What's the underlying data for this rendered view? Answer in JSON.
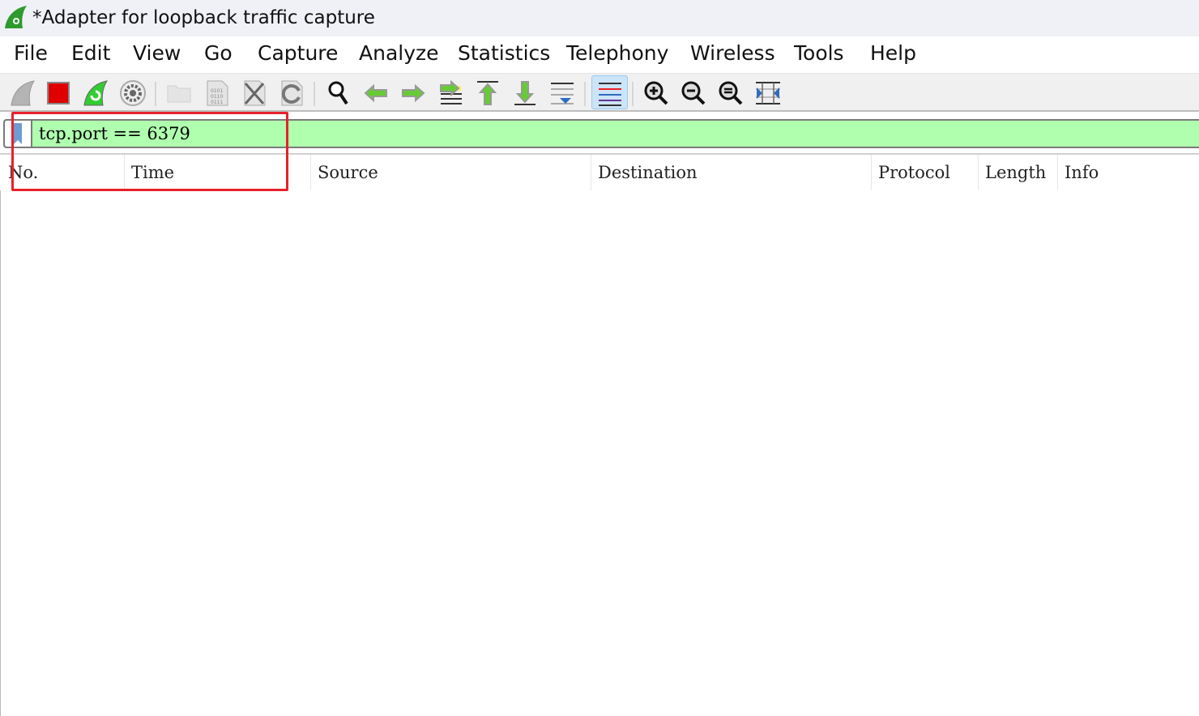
{
  "window": {
    "title": "*Adapter for loopback traffic capture",
    "icon": "wireshark-fin-icon"
  },
  "menu": [
    "File",
    "Edit",
    "View",
    "Go",
    "Capture",
    "Analyze",
    "Statistics",
    "Telephony",
    "Wireless",
    "Tools",
    "Help"
  ],
  "toolbar": [
    {
      "name": "start-capture",
      "icon": "shark-fin-icon"
    },
    {
      "name": "stop-capture",
      "icon": "stop-square-icon"
    },
    {
      "name": "restart-capture",
      "icon": "restart-fin-icon"
    },
    {
      "name": "capture-options",
      "icon": "gear-icon"
    },
    {
      "name": "open-file",
      "icon": "folder-icon"
    },
    {
      "name": "save-file",
      "icon": "binary-file-icon"
    },
    {
      "name": "close-file",
      "icon": "close-file-icon"
    },
    {
      "name": "reload-file",
      "icon": "reload-icon"
    },
    {
      "name": "find-packet",
      "icon": "magnifier-icon"
    },
    {
      "name": "go-back",
      "icon": "arrow-left-icon"
    },
    {
      "name": "go-forward",
      "icon": "arrow-right-icon"
    },
    {
      "name": "go-to-packet",
      "icon": "jump-icon"
    },
    {
      "name": "first-packet",
      "icon": "arrow-up-bar-icon"
    },
    {
      "name": "last-packet",
      "icon": "arrow-down-bar-icon"
    },
    {
      "name": "auto-scroll",
      "icon": "autoscroll-icon"
    },
    {
      "name": "colorize",
      "icon": "colorize-lines-icon",
      "active": true
    },
    {
      "name": "zoom-in",
      "icon": "zoom-in-icon"
    },
    {
      "name": "zoom-out",
      "icon": "zoom-out-icon"
    },
    {
      "name": "normal-size",
      "icon": "zoom-reset-icon"
    },
    {
      "name": "resize-columns",
      "icon": "resize-columns-icon"
    }
  ],
  "filter": {
    "value": "tcp.port == 6379",
    "icon": "bookmark-icon",
    "valid_color": "#afffaf"
  },
  "columns": [
    "No.",
    "Time",
    "Source",
    "Destination",
    "Protocol",
    "Length",
    "Info"
  ],
  "annotation_color": "#e8212b"
}
